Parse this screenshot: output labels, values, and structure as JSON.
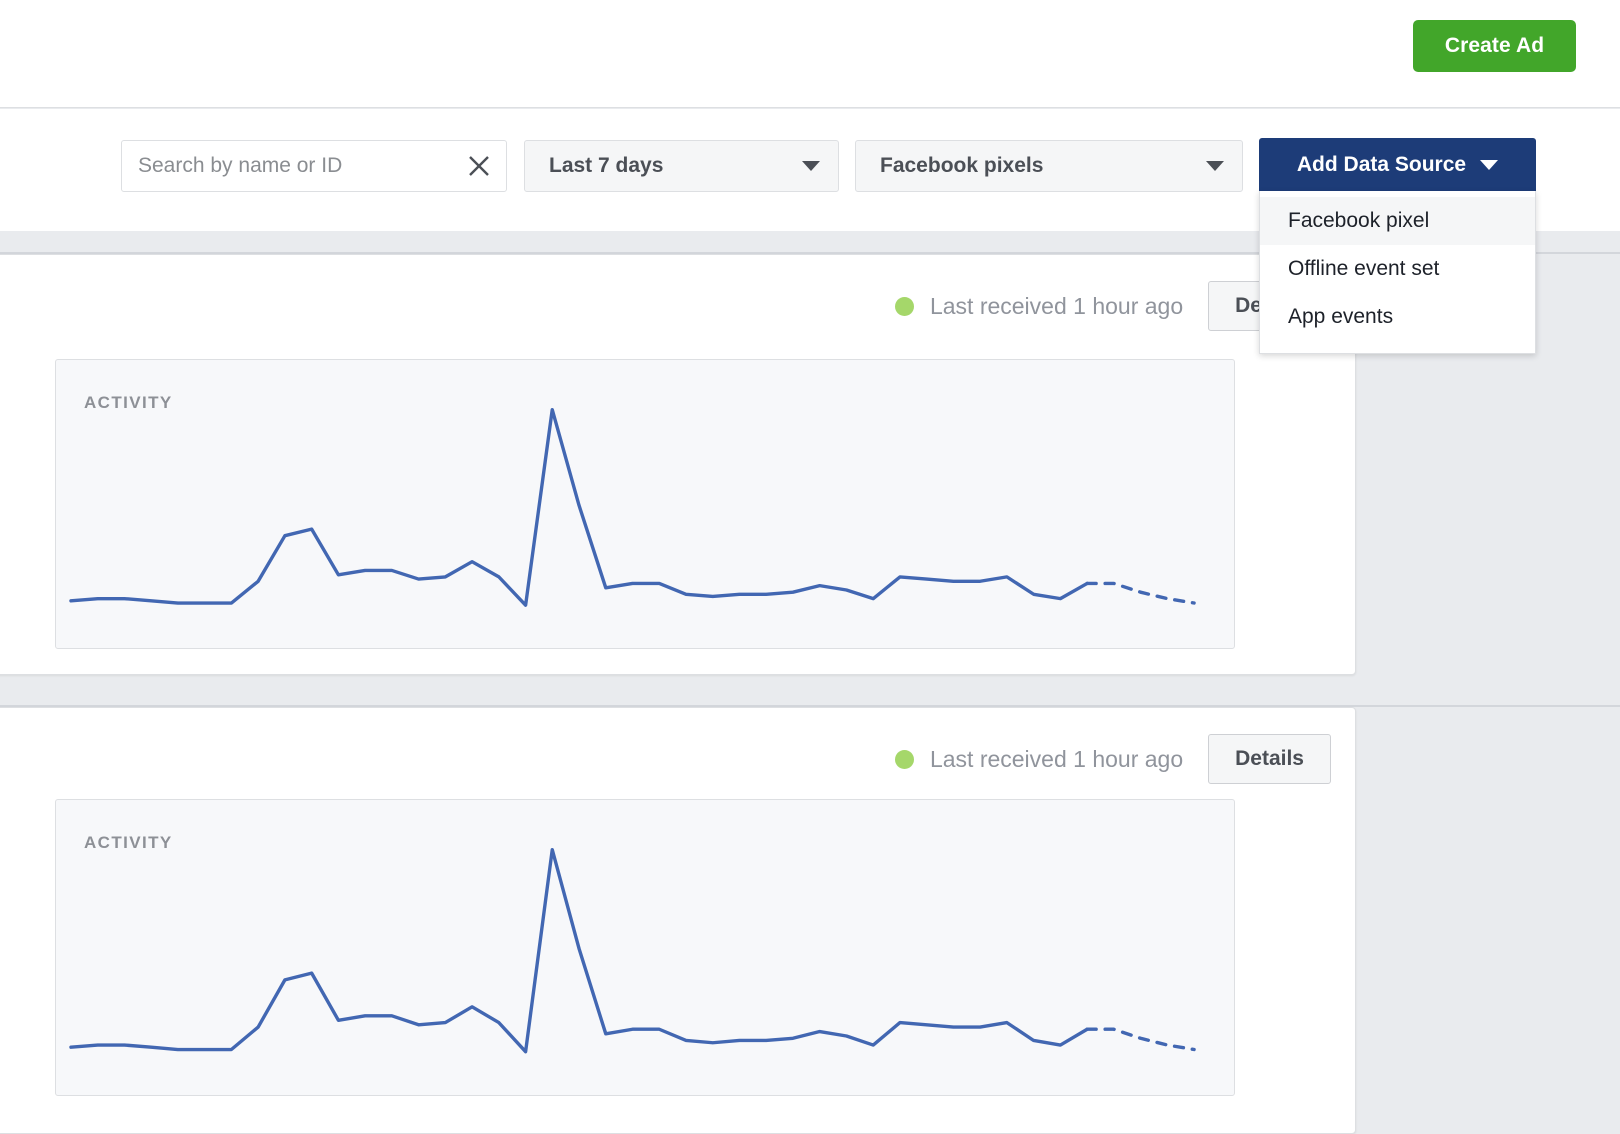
{
  "header": {
    "create_ad_label": "Create Ad"
  },
  "toolbar": {
    "search": {
      "placeholder": "Search by name or ID",
      "value": "",
      "clear_icon": "close-icon"
    },
    "date_range": {
      "selected": "Last 7 days",
      "caret_icon": "chevron-down-icon"
    },
    "source_type": {
      "selected": "Facebook pixels",
      "caret_icon": "chevron-down-icon"
    },
    "add_data_source": {
      "label": "Add Data Source",
      "caret_icon": "chevron-down-icon",
      "expanded": true,
      "menu_items": [
        {
          "label": "Facebook pixel",
          "highlighted": true
        },
        {
          "label": "Offline event set",
          "highlighted": false
        },
        {
          "label": "App events",
          "highlighted": false
        }
      ]
    }
  },
  "colors": {
    "brand_blue": "#1d3c78",
    "create_ad_green": "#42a62a",
    "status_green": "#a5d76a",
    "chart_line": "#4267b2",
    "page_background": "#e9ebee",
    "panel_background": "#f7f8fa"
  },
  "cards": [
    {
      "status_text": "Last received 1 hour ago",
      "status_dot": "status-green-dot",
      "details_label": "Details",
      "activity_label": "ACTIVITY"
    },
    {
      "status_text": "Last received 1 hour ago",
      "status_dot": "status-green-dot",
      "details_label": "Details",
      "activity_label": "ACTIVITY"
    }
  ],
  "chart_data": {
    "type": "line",
    "title": "ACTIVITY",
    "xlabel": "",
    "ylabel": "",
    "grid": false,
    "legend": null,
    "axis_labels_shown": false,
    "ylim": [
      0,
      100
    ],
    "series": [
      {
        "name": "Activity",
        "solid_values": [
          8,
          9,
          9,
          8,
          7,
          7,
          7,
          17,
          38,
          41,
          20,
          22,
          22,
          18,
          19,
          26,
          19,
          6,
          96,
          52,
          14,
          16,
          16,
          11,
          10,
          11,
          11,
          12,
          15,
          13,
          9,
          19,
          18,
          17,
          17,
          19,
          11,
          9,
          16
        ],
        "dashed_tail_values": [
          16,
          12,
          9,
          7
        ],
        "dashed_note": "projected / incomplete final interval"
      }
    ]
  }
}
